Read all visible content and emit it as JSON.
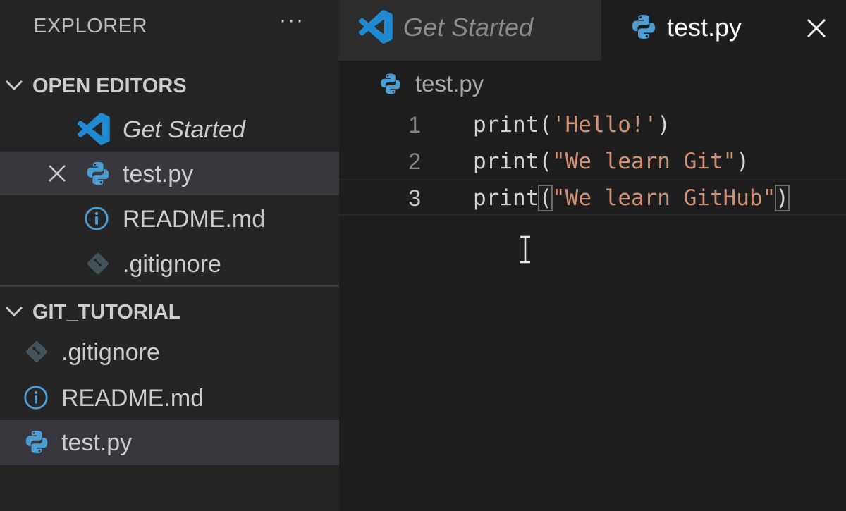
{
  "sidebar": {
    "title": "EXPLORER",
    "more_label": "···",
    "open_editors": {
      "title": "OPEN EDITORS",
      "items": [
        {
          "label": "Get Started",
          "icon": "vscode-logo-icon"
        },
        {
          "label": "test.py",
          "icon": "python-icon"
        },
        {
          "label": "README.md",
          "icon": "info-icon"
        },
        {
          "label": ".gitignore",
          "icon": "git-icon"
        }
      ]
    },
    "workspace": {
      "title": "GIT_TUTORIAL",
      "items": [
        {
          "label": ".gitignore",
          "icon": "git-icon"
        },
        {
          "label": "README.md",
          "icon": "info-icon"
        },
        {
          "label": "test.py",
          "icon": "python-icon"
        }
      ]
    }
  },
  "tabs": [
    {
      "label": "Get Started",
      "icon": "vscode-logo-icon",
      "active": false
    },
    {
      "label": "test.py",
      "icon": "python-icon",
      "active": true
    }
  ],
  "breadcrumb": {
    "label": "test.py",
    "icon": "python-icon"
  },
  "editor": {
    "lines": [
      {
        "number": "1",
        "fn": "print(",
        "str": "'Hello!'",
        "end": ")"
      },
      {
        "number": "2",
        "fn": "print(",
        "str": "\"We learn Git\"",
        "end": ")"
      },
      {
        "number": "3",
        "fn": "print",
        "open": "(",
        "str": "\"We learn GitHub\"",
        "end": ")"
      }
    ]
  },
  "colors": {
    "sidebar_bg": "#252526",
    "editor_bg": "#1e1e1e",
    "selection_bg": "#37373d",
    "string": "#ce9178",
    "python_blue": "#4b9ed3",
    "vscode_blue": "#1f8ad2"
  }
}
